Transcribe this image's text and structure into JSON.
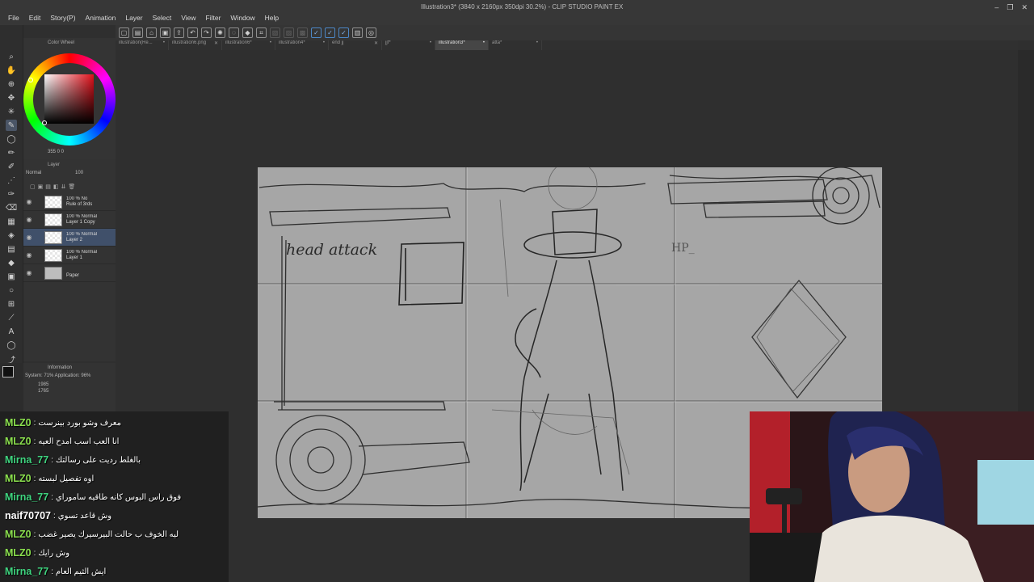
{
  "window": {
    "title": "Illustration3* (3840 x 2160px 350dpi 30.2%) - CLIP STUDIO PAINT EX",
    "controls": [
      "–",
      "❐",
      "✕"
    ]
  },
  "menu": [
    "File",
    "Edit",
    "Story(P)",
    "Animation",
    "Layer",
    "Select",
    "View",
    "Filter",
    "Window",
    "Help"
  ],
  "tabs": [
    {
      "label": "illustration(Re..."
    },
    {
      "label": "illustration6.png"
    },
    {
      "label": "illustration6*"
    },
    {
      "label": "illustration4*"
    },
    {
      "label": "end jj"
    },
    {
      "label": "jjf*"
    },
    {
      "label": "illustration3*"
    },
    {
      "label": "atta*"
    }
  ],
  "color_panel": {
    "title": "Color Wheel",
    "values": "355  0  0"
  },
  "layer_panel": {
    "title": "Layer",
    "blend_mode": "Normal",
    "opacity": "100",
    "layers": [
      {
        "line1": "100 % No",
        "line2": "Rule of 3rds"
      },
      {
        "line1": "100 % Normal",
        "line2": "Layer 1 Copy"
      },
      {
        "line1": "100 % Normal",
        "line2": "Layer 2"
      },
      {
        "line1": "100 % Normal",
        "line2": "Layer 1"
      },
      {
        "line1": "",
        "line2": "Paper"
      }
    ]
  },
  "info_panel": {
    "title": "Information",
    "system": "System: 71%  Application: 96%",
    "x": "1985",
    "y": "1765",
    "h_label": "H:",
    "v_label": "V:"
  },
  "chat": [
    {
      "user": "MLZ0",
      "color": "#8be04e",
      "msg": "معرف وشو بورد بينرست"
    },
    {
      "user": "MLZ0",
      "color": "#8be04e",
      "msg": "انا العب اسب امدح العيه"
    },
    {
      "user": "Mirna_77",
      "color": "#3fd47f",
      "msg": "بالغلط رديت على رسالتك"
    },
    {
      "user": "MLZ0",
      "color": "#8be04e",
      "msg": "اوه تفصيل لبسته"
    },
    {
      "user": "Mirna_77",
      "color": "#3fd47f",
      "msg": "فوق راس البوس كانه طاقيه ساموراي"
    },
    {
      "user": "naif70707",
      "color": "#ffffff",
      "msg": "وش قاعد تسوي"
    },
    {
      "user": "MLZ0",
      "color": "#8be04e",
      "msg": "ليه الخوف ب حالت البيرسيرك يصير غضب"
    },
    {
      "user": "MLZ0",
      "color": "#8be04e",
      "msg": "وش رايك"
    },
    {
      "user": "Mirna_77",
      "color": "#3fd47f",
      "msg": "ايش الثيم العام"
    }
  ],
  "canvas": {
    "sketch_text_1": "head attack",
    "sketch_text_2": "HP_"
  }
}
